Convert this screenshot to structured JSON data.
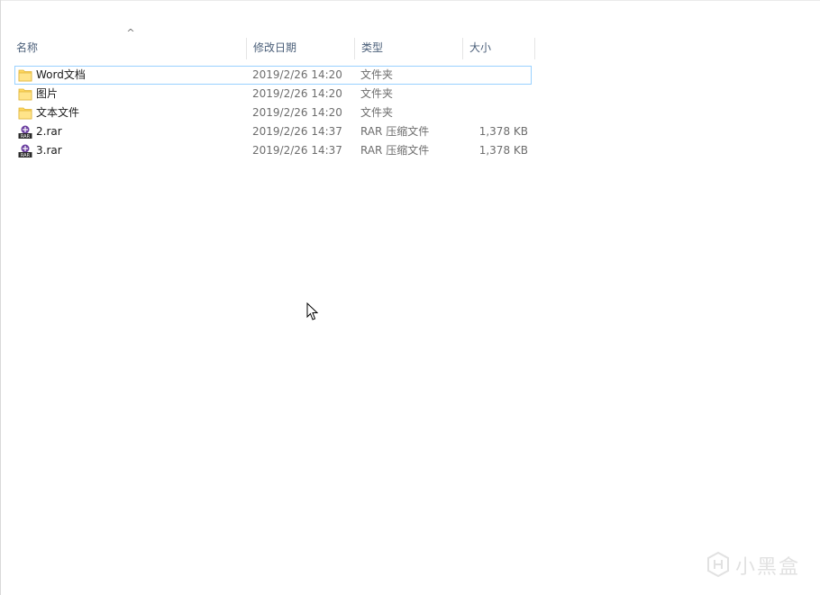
{
  "columns": {
    "name": "名称",
    "date": "修改日期",
    "type": "类型",
    "size": "大小"
  },
  "sort": {
    "column": "name",
    "direction": "ascending",
    "indicator": "^"
  },
  "files": [
    {
      "name": "Word文档",
      "date": "2019/2/26 14:20",
      "type": "文件夹",
      "size": "",
      "icon": "folder-icon",
      "selected": true
    },
    {
      "name": "图片",
      "date": "2019/2/26 14:20",
      "type": "文件夹",
      "size": "",
      "icon": "folder-icon",
      "selected": false
    },
    {
      "name": "文本文件",
      "date": "2019/2/26 14:20",
      "type": "文件夹",
      "size": "",
      "icon": "folder-icon",
      "selected": false
    },
    {
      "name": "2.rar",
      "date": "2019/2/26 14:37",
      "type": "RAR 压缩文件",
      "size": "1,378 KB",
      "icon": "rar-archive-icon",
      "selected": false
    },
    {
      "name": "3.rar",
      "date": "2019/2/26 14:37",
      "type": "RAR 压缩文件",
      "size": "1,378 KB",
      "icon": "rar-archive-icon",
      "selected": false
    }
  ],
  "watermark": {
    "text": "小黑盒",
    "icon": "heybox-logo-icon"
  },
  "colors": {
    "selection_border": "#99d1ff",
    "header_text": "#4c607a",
    "folder_yellow": "#ffd75e",
    "rar_purple": "#6b3fa0"
  }
}
